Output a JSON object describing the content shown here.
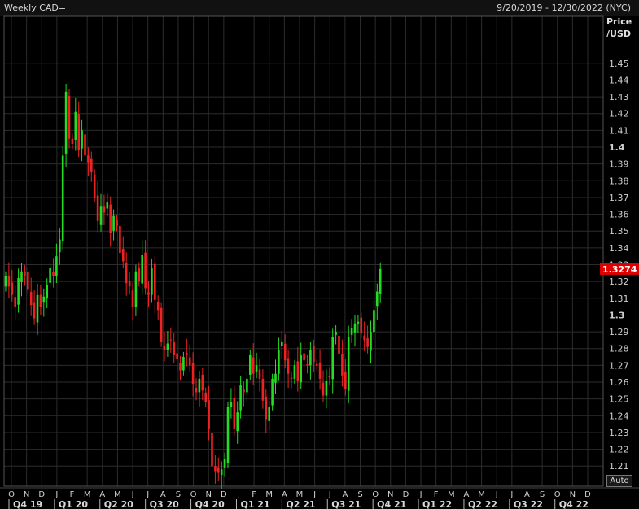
{
  "header": {
    "title": "Weekly CAD=",
    "date_range": "9/20/2019 - 12/30/2022 (NYC)"
  },
  "axis": {
    "ylabel_line1": "Price",
    "ylabel_line2": "/USD",
    "auto_button": "Auto"
  },
  "chart_data": {
    "type": "candlestick",
    "title": "Weekly CAD=",
    "ylabel": "Price /USD",
    "ylim": [
      1.198,
      1.478
    ],
    "y_ticks": [
      1.21,
      1.22,
      1.23,
      1.24,
      1.25,
      1.26,
      1.27,
      1.28,
      1.29,
      1.3,
      1.31,
      1.32,
      1.33,
      1.34,
      1.35,
      1.36,
      1.37,
      1.38,
      1.39,
      1.4,
      1.41,
      1.42,
      1.43,
      1.44,
      1.45
    ],
    "y_tick_labels": [
      "1.21",
      "1.22",
      "1.23",
      "1.24",
      "1.25",
      "1.26",
      "1.27",
      "1.28",
      "1.29",
      "1.3",
      "1.31",
      "1.32",
      "1.33",
      "1.34",
      "1.35",
      "1.36",
      "1.37",
      "1.38",
      "1.39",
      "1.4",
      "1.41",
      "1.42",
      "1.43",
      "1.44",
      "1.45"
    ],
    "y_bold_ticks": [
      "1.3",
      "1.4"
    ],
    "last_price": "1.3274",
    "last_price_color": "#e00000",
    "up_color": "#22dd22",
    "down_color": "#ee2222",
    "grid": true,
    "month_labels": [
      "O",
      "N",
      "D",
      "J",
      "F",
      "M",
      "A",
      "M",
      "J",
      "J",
      "A",
      "S",
      "O",
      "N",
      "D",
      "J",
      "F",
      "M",
      "A",
      "M",
      "J",
      "J",
      "A",
      "S",
      "O",
      "N",
      "D",
      "J",
      "F",
      "M",
      "A",
      "M",
      "J",
      "J",
      "A",
      "S",
      "O",
      "N",
      "D"
    ],
    "quarter_labels": [
      "Q4 19",
      "Q1 20",
      "Q2 20",
      "Q3 20",
      "Q4 20",
      "Q1 21",
      "Q2 21",
      "Q3 21",
      "Q4 21",
      "Q1 22",
      "Q2 22",
      "Q3 22",
      "Q4 22"
    ],
    "closes": [
      1.323,
      1.317,
      1.312,
      1.305,
      1.322,
      1.326,
      1.323,
      1.315,
      1.306,
      1.298,
      1.312,
      1.305,
      1.311,
      1.318,
      1.328,
      1.323,
      1.335,
      1.345,
      1.395,
      1.433,
      1.405,
      1.402,
      1.421,
      1.398,
      1.41,
      1.395,
      1.391,
      1.385,
      1.37,
      1.356,
      1.365,
      1.361,
      1.367,
      1.349,
      1.359,
      1.353,
      1.337,
      1.332,
      1.319,
      1.317,
      1.305,
      1.326,
      1.32,
      1.336,
      1.316,
      1.312,
      1.328,
      1.309,
      1.303,
      1.284,
      1.279,
      1.283,
      1.285,
      1.276,
      1.274,
      1.267,
      1.275,
      1.276,
      1.27,
      1.259,
      1.254,
      1.262,
      1.255,
      1.248,
      1.232,
      1.21,
      1.207,
      1.206,
      1.208,
      1.214,
      1.245,
      1.248,
      1.232,
      1.242,
      1.258,
      1.254,
      1.262,
      1.276,
      1.265,
      1.27,
      1.262,
      1.249,
      1.238,
      1.245,
      1.262,
      1.265,
      1.279,
      1.284,
      1.273,
      1.265,
      1.262,
      1.27,
      1.261,
      1.276,
      1.273,
      1.27,
      1.279,
      1.272,
      1.27,
      1.262,
      1.252,
      1.261,
      1.263,
      1.287,
      1.29,
      1.277,
      1.264,
      1.256,
      1.287,
      1.292,
      1.295,
      1.296,
      1.289,
      1.285,
      1.281,
      1.29,
      1.303,
      1.314,
      1.3274
    ]
  }
}
